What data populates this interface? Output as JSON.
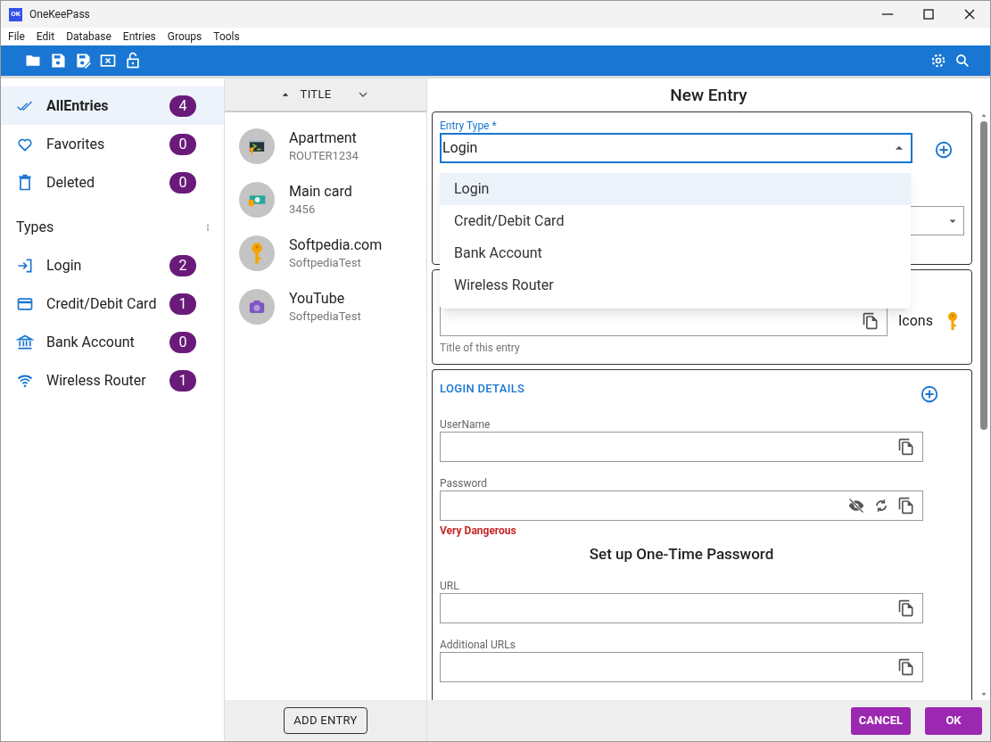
{
  "window": {
    "title": "OneKeePass",
    "logo": "OK"
  },
  "menu": [
    "File",
    "Edit",
    "Database",
    "Entries",
    "Groups",
    "Tools"
  ],
  "sidebar": {
    "categories": [
      {
        "label": "AllEntries",
        "count": "4",
        "selected": true
      },
      {
        "label": "Favorites",
        "count": "0",
        "selected": false
      },
      {
        "label": "Deleted",
        "count": "0",
        "selected": false
      }
    ],
    "types_heading": "Types",
    "types": [
      {
        "label": "Login",
        "count": "2",
        "selected": false
      },
      {
        "label": "Credit/Debit Card",
        "count": "1",
        "selected": false
      },
      {
        "label": "Bank Account",
        "count": "0",
        "selected": false
      },
      {
        "label": "Wireless Router",
        "count": "1",
        "selected": false
      }
    ]
  },
  "entry_list": {
    "sort_label": "TITLE",
    "entries": [
      {
        "title": "Apartment",
        "subtitle": "ROUTER1234"
      },
      {
        "title": "Main card",
        "subtitle": "3456"
      },
      {
        "title": "Softpedia.com",
        "subtitle": "SoftpediaTest"
      },
      {
        "title": "YouTube",
        "subtitle": "SoftpediaTest"
      }
    ],
    "add_button": "ADD ENTRY"
  },
  "form": {
    "heading": "New Entry",
    "entry_type": {
      "label": "Entry Type *",
      "value": "Login",
      "expanded": true,
      "options": [
        {
          "label": "Login",
          "selected": true
        },
        {
          "label": "Credit/Debit Card",
          "selected": false
        },
        {
          "label": "Bank Account",
          "selected": false
        },
        {
          "label": "Wireless Router",
          "selected": false
        }
      ]
    },
    "title_helper": "Title of this entry",
    "icons_label": "Icons",
    "section_heading": "LOGIN DETAILS",
    "fields": [
      {
        "label": "UserName",
        "kind": "text"
      },
      {
        "label": "Password",
        "kind": "password",
        "strength": "Very Dangerous"
      },
      {
        "label": "URL",
        "kind": "text"
      },
      {
        "label": "Additional URLs",
        "kind": "text"
      }
    ],
    "otp_heading": "Set up One-Time Password",
    "buttons": [
      "CANCEL",
      "OK"
    ]
  }
}
